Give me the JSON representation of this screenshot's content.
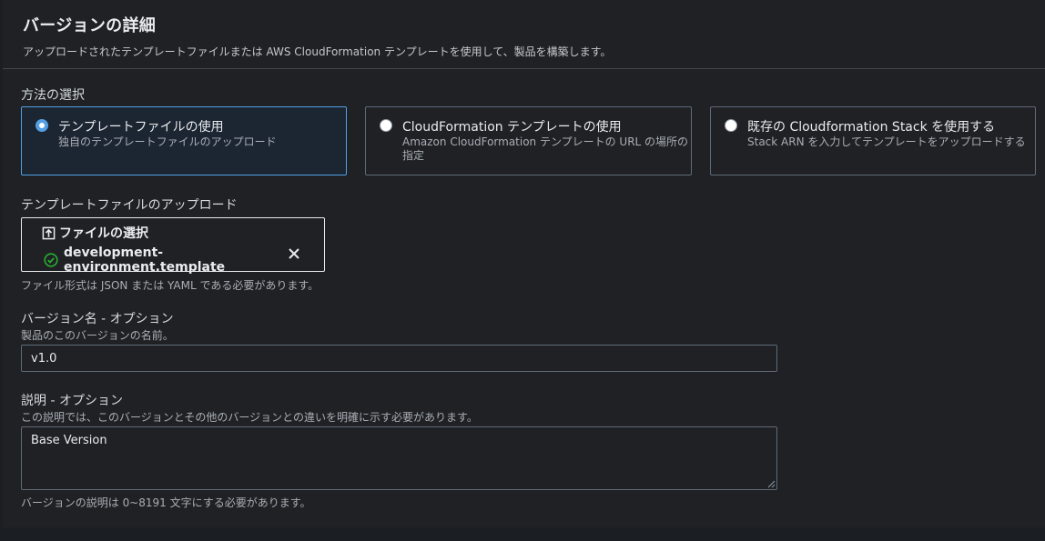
{
  "header": {
    "title": "バージョンの詳細",
    "subtitle": "アップロードされたテンプレートファイルまたは AWS CloudFormation テンプレートを使用して、製品を構築します。"
  },
  "method": {
    "label": "方法の選択",
    "options": [
      {
        "title": "テンプレートファイルの使用",
        "description": "独自のテンプレートファイルのアップロード",
        "selected": true
      },
      {
        "title": "CloudFormation テンプレートの使用",
        "description_line1": "Amazon CloudFormation テンプレートの URL の場所の",
        "description_line2": "指定",
        "selected": false
      },
      {
        "title": "既存の Cloudformation Stack を使用する",
        "description": "Stack ARN を入力してテンプレートをアップロードする",
        "selected": false
      }
    ]
  },
  "upload": {
    "label": "テンプレートファイルのアップロード",
    "choose_button": "ファイルの選択",
    "file_name": "development-environment.template",
    "hint": "ファイル形式は JSON または YAML である必要があります。"
  },
  "version_name": {
    "label": "バージョン名 - オプション",
    "description": "製品のこのバージョンの名前。",
    "value": "v1.0"
  },
  "description_field": {
    "label": "説明 - オプション",
    "description": "この説明では、このバージョンとその他のバージョンとの違いを明確に示す必要があります。",
    "value": "Base Version",
    "hint": "バージョンの説明は 0~8191 文字にする必要があります。"
  },
  "colors": {
    "accent": "#539fe5",
    "success": "#29ad32",
    "background": "#1f2124",
    "border": "#5f6b7a"
  },
  "icons": [
    "upload-icon",
    "check-circle-icon",
    "remove-icon"
  ]
}
